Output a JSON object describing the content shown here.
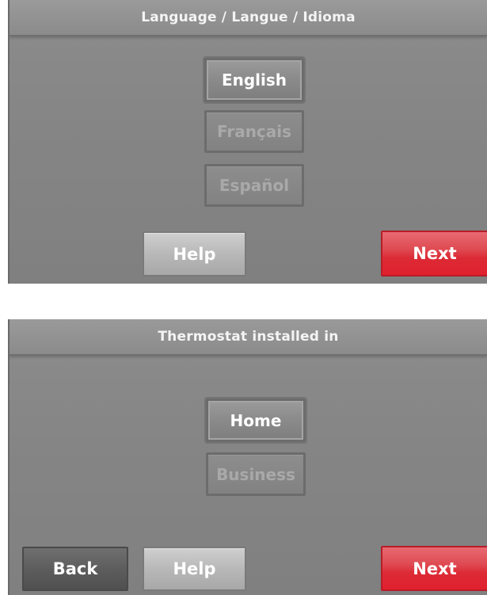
{
  "colors": {
    "screen_bg": "#858585",
    "next_button": "#e0202d",
    "back_button": "#5d5d5d",
    "help_button": "#b8b8b8"
  },
  "language_screen": {
    "title": "Language / Langue /  Idioma",
    "options": [
      {
        "label": "English",
        "selected": true
      },
      {
        "label": "Français",
        "selected": false
      },
      {
        "label": "Español",
        "selected": false
      }
    ],
    "help_label": "Help",
    "next_label": "Next"
  },
  "location_screen": {
    "title": "Thermostat installed in",
    "options": [
      {
        "label": "Home",
        "selected": true
      },
      {
        "label": "Business",
        "selected": false
      }
    ],
    "back_label": "Back",
    "help_label": "Help",
    "next_label": "Next"
  }
}
